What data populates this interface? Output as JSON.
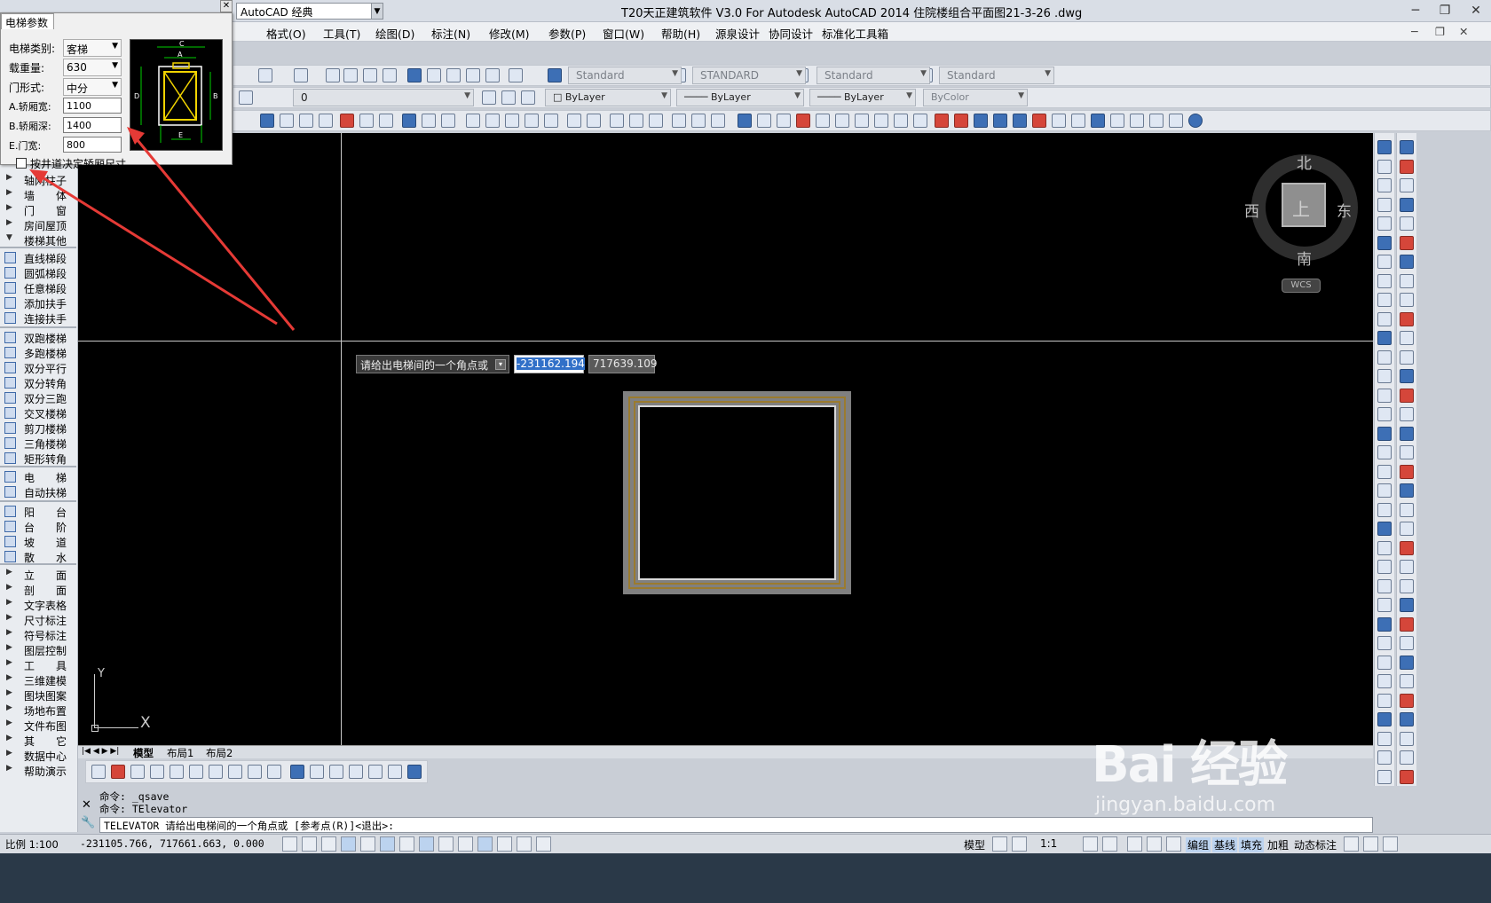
{
  "titlebar": {
    "workspace": "AutoCAD 经典",
    "title": "T20天正建筑软件 V3.0 For Autodesk AutoCAD 2014    住院楼组合平面图21-3-26 .dwg"
  },
  "menu": [
    "格式(O)",
    "工具(T)",
    "绘图(D)",
    "标注(N)",
    "修改(M)",
    "参数(P)",
    "窗口(W)",
    "帮助(H)",
    "源泉设计",
    "协同设计",
    "标准化工具箱"
  ],
  "styles": {
    "text_style": "Standard",
    "dim_style": "STANDARD",
    "table_style": "Standard",
    "mleader_style": "Standard"
  },
  "layers": {
    "current_layer": "0",
    "color": "ByLayer",
    "linetype": "ByLayer",
    "lineweight": "ByLayer",
    "plotstyle": "ByColor"
  },
  "dialog": {
    "title": "电梯参数",
    "fields": {
      "type_label": "电梯类别:",
      "type_value": "客梯",
      "load_label": "载重量:",
      "load_value": "630",
      "door_label": "门形式:",
      "door_value": "中分",
      "car_width_label": "A.轿厢宽:",
      "car_width_value": "1100",
      "car_depth_label": "B.轿厢深:",
      "car_depth_value": "1400",
      "door_width_label": "E.门宽:",
      "door_width_value": "800"
    },
    "checkbox_label": "按井道决定轿厢尺寸",
    "preview_labels": [
      "C",
      "A",
      "D",
      "B",
      "E"
    ]
  },
  "sidebar": {
    "items": [
      {
        "label": "轴网柱子",
        "type": "group"
      },
      {
        "label": "墙　　体",
        "type": "group"
      },
      {
        "label": "门　　窗",
        "type": "group"
      },
      {
        "label": "房间屋顶",
        "type": "group"
      },
      {
        "label": "楼梯其他",
        "type": "group-open"
      },
      {
        "label": "直线梯段",
        "type": "tool"
      },
      {
        "label": "圆弧梯段",
        "type": "tool"
      },
      {
        "label": "任意梯段",
        "type": "tool"
      },
      {
        "label": "添加扶手",
        "type": "tool"
      },
      {
        "label": "连接扶手",
        "type": "tool"
      },
      {
        "label": "双跑楼梯",
        "type": "tool"
      },
      {
        "label": "多跑楼梯",
        "type": "tool"
      },
      {
        "label": "双分平行",
        "type": "tool"
      },
      {
        "label": "双分转角",
        "type": "tool"
      },
      {
        "label": "双分三跑",
        "type": "tool"
      },
      {
        "label": "交叉楼梯",
        "type": "tool"
      },
      {
        "label": "剪刀楼梯",
        "type": "tool"
      },
      {
        "label": "三角楼梯",
        "type": "tool"
      },
      {
        "label": "矩形转角",
        "type": "tool"
      },
      {
        "label": "电　　梯",
        "type": "tool"
      },
      {
        "label": "自动扶梯",
        "type": "tool"
      },
      {
        "label": "阳　　台",
        "type": "tool"
      },
      {
        "label": "台　　阶",
        "type": "tool"
      },
      {
        "label": "坡　　道",
        "type": "tool"
      },
      {
        "label": "散　　水",
        "type": "tool"
      },
      {
        "label": "立　　面",
        "type": "group"
      },
      {
        "label": "剖　　面",
        "type": "group"
      },
      {
        "label": "文字表格",
        "type": "group"
      },
      {
        "label": "尺寸标注",
        "type": "group"
      },
      {
        "label": "符号标注",
        "type": "group"
      },
      {
        "label": "图层控制",
        "type": "group"
      },
      {
        "label": "工　　具",
        "type": "group"
      },
      {
        "label": "三维建模",
        "type": "group"
      },
      {
        "label": "图块图案",
        "type": "group"
      },
      {
        "label": "场地布置",
        "type": "group"
      },
      {
        "label": "文件布图",
        "type": "group"
      },
      {
        "label": "其　　它",
        "type": "group"
      },
      {
        "label": "数据中心",
        "type": "group"
      },
      {
        "label": "帮助演示",
        "type": "group"
      }
    ]
  },
  "canvas": {
    "prompt": "请给出电梯间的一个角点或",
    "coord_x": "-231162.194",
    "coord_y": "717639.109",
    "compass": {
      "north": "北",
      "south": "南",
      "east": "东",
      "west": "西",
      "center": "上",
      "wcs": "WCS"
    },
    "ucs_x": "X",
    "ucs_y": "Y"
  },
  "layout_tabs": [
    "模型",
    "布局1",
    "布局2"
  ],
  "command": {
    "history1": "命令: _qsave",
    "history2": "命令: TElevator",
    "current": "TELEVATOR 请给出电梯间的一个角点或 [参考点(R)]<退出>:"
  },
  "status": {
    "scale": "比例 1:100",
    "coords": "-231105.766, 717661.663, 0.000",
    "model_label": "模型",
    "annot_scale": "1:1",
    "toggles": [
      "编组",
      "基线",
      "填充",
      "加粗",
      "动态标注"
    ]
  },
  "watermark": {
    "logo": "Bai 经验",
    "url": "jingyan.baidu.com"
  }
}
